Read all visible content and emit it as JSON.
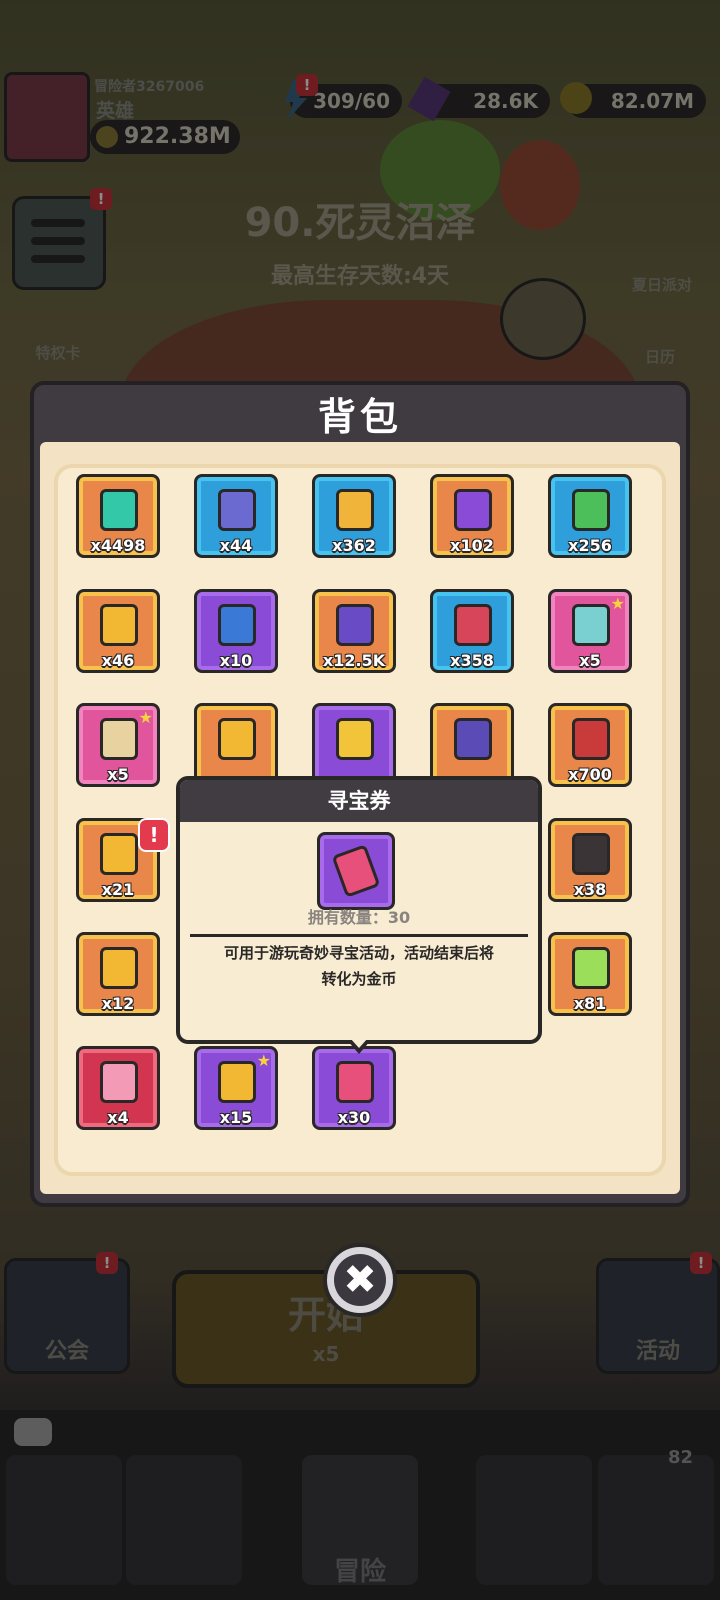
{
  "hud": {
    "player_name": "冒险者3267006",
    "player_title": "英雄",
    "gold_main": "922.38M",
    "energy": "309/60",
    "gems": "28.6K",
    "coins": "82.07M",
    "energy_badge": "!"
  },
  "background": {
    "stage_title": "90.死灵沼泽",
    "stage_subtitle": "最高生存天数:4天",
    "left_button_1": "特权卡",
    "right_button_1": "夏日派对",
    "right_button_2": "日历",
    "bottom_left": "公会",
    "bottom_right": "活动",
    "start_label": "开始",
    "start_cost": "x5",
    "nav_adventure": "冒险",
    "nav_count": "82"
  },
  "modal": {
    "title": "背包",
    "items": [
      {
        "icon": "gem-paw-icon",
        "count": "x4498",
        "color": "orange"
      },
      {
        "icon": "eye-book-icon",
        "count": "x44",
        "color": "blue"
      },
      {
        "icon": "gold-skill-book-icon",
        "count": "x362",
        "color": "blue"
      },
      {
        "icon": "wizard-hat-icon",
        "count": "x102",
        "color": "orange"
      },
      {
        "icon": "leaf-book-icon",
        "count": "x256",
        "color": "blue"
      },
      {
        "icon": "paw-badge-icon",
        "count": "x46",
        "color": "orange"
      },
      {
        "icon": "ticket-blue-icon",
        "count": "x10",
        "color": "purple"
      },
      {
        "icon": "shield-gem-icon",
        "count": "x12.5K",
        "color": "orange"
      },
      {
        "icon": "red-book-icon",
        "count": "x358",
        "color": "blue"
      },
      {
        "icon": "fish-pet-icon",
        "count": "x5",
        "color": "pink"
      },
      {
        "icon": "treasure-ship-icon",
        "count": "x5",
        "color": "pink"
      },
      {
        "icon": "puzzle-icon",
        "count": "",
        "color": "orange"
      },
      {
        "icon": "ring-icon",
        "count": "",
        "color": "purple"
      },
      {
        "icon": "rune-book-icon",
        "count": "",
        "color": "orange"
      },
      {
        "icon": "fire-shield-icon",
        "count": "x700",
        "color": "orange"
      },
      {
        "icon": "golden-chest-icon",
        "count": "x21",
        "color": "orange"
      },
      {
        "icon": "dark-hat-icon",
        "count": "x38",
        "color": "orange"
      },
      {
        "icon": "key-icon",
        "count": "x12",
        "color": "orange"
      },
      {
        "icon": "green-drink-icon",
        "count": "x81",
        "color": "orange"
      },
      {
        "icon": "pink-drink-icon",
        "count": "x4",
        "color": "red"
      },
      {
        "icon": "helmet-chest-icon",
        "count": "x15",
        "color": "purple"
      },
      {
        "icon": "treasure-ticket-icon",
        "count": "x30",
        "color": "purple"
      }
    ]
  },
  "tooltip": {
    "title": "寻宝券",
    "owned_label": "拥有数量：30",
    "desc_line1": "可用于游玩奇妙寻宝活动，活动结束后将",
    "desc_line2": "转化为金币"
  },
  "close_button": "✖",
  "alert_mark": "!"
}
